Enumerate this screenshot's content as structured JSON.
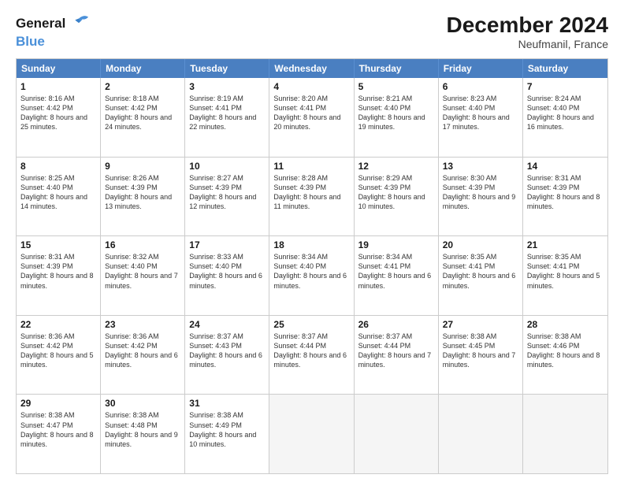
{
  "logo": {
    "line1": "General",
    "line2": "Blue"
  },
  "title": "December 2024",
  "subtitle": "Neufmanil, France",
  "days": [
    "Sunday",
    "Monday",
    "Tuesday",
    "Wednesday",
    "Thursday",
    "Friday",
    "Saturday"
  ],
  "weeks": [
    [
      {
        "day": "1",
        "sunrise": "8:16 AM",
        "sunset": "4:42 PM",
        "daylight": "8 hours and 25 minutes."
      },
      {
        "day": "2",
        "sunrise": "8:18 AM",
        "sunset": "4:42 PM",
        "daylight": "8 hours and 24 minutes."
      },
      {
        "day": "3",
        "sunrise": "8:19 AM",
        "sunset": "4:41 PM",
        "daylight": "8 hours and 22 minutes."
      },
      {
        "day": "4",
        "sunrise": "8:20 AM",
        "sunset": "4:41 PM",
        "daylight": "8 hours and 20 minutes."
      },
      {
        "day": "5",
        "sunrise": "8:21 AM",
        "sunset": "4:40 PM",
        "daylight": "8 hours and 19 minutes."
      },
      {
        "day": "6",
        "sunrise": "8:23 AM",
        "sunset": "4:40 PM",
        "daylight": "8 hours and 17 minutes."
      },
      {
        "day": "7",
        "sunrise": "8:24 AM",
        "sunset": "4:40 PM",
        "daylight": "8 hours and 16 minutes."
      }
    ],
    [
      {
        "day": "8",
        "sunrise": "8:25 AM",
        "sunset": "4:40 PM",
        "daylight": "8 hours and 14 minutes."
      },
      {
        "day": "9",
        "sunrise": "8:26 AM",
        "sunset": "4:39 PM",
        "daylight": "8 hours and 13 minutes."
      },
      {
        "day": "10",
        "sunrise": "8:27 AM",
        "sunset": "4:39 PM",
        "daylight": "8 hours and 12 minutes."
      },
      {
        "day": "11",
        "sunrise": "8:28 AM",
        "sunset": "4:39 PM",
        "daylight": "8 hours and 11 minutes."
      },
      {
        "day": "12",
        "sunrise": "8:29 AM",
        "sunset": "4:39 PM",
        "daylight": "8 hours and 10 minutes."
      },
      {
        "day": "13",
        "sunrise": "8:30 AM",
        "sunset": "4:39 PM",
        "daylight": "8 hours and 9 minutes."
      },
      {
        "day": "14",
        "sunrise": "8:31 AM",
        "sunset": "4:39 PM",
        "daylight": "8 hours and 8 minutes."
      }
    ],
    [
      {
        "day": "15",
        "sunrise": "8:31 AM",
        "sunset": "4:39 PM",
        "daylight": "8 hours and 8 minutes."
      },
      {
        "day": "16",
        "sunrise": "8:32 AM",
        "sunset": "4:40 PM",
        "daylight": "8 hours and 7 minutes."
      },
      {
        "day": "17",
        "sunrise": "8:33 AM",
        "sunset": "4:40 PM",
        "daylight": "8 hours and 6 minutes."
      },
      {
        "day": "18",
        "sunrise": "8:34 AM",
        "sunset": "4:40 PM",
        "daylight": "8 hours and 6 minutes."
      },
      {
        "day": "19",
        "sunrise": "8:34 AM",
        "sunset": "4:41 PM",
        "daylight": "8 hours and 6 minutes."
      },
      {
        "day": "20",
        "sunrise": "8:35 AM",
        "sunset": "4:41 PM",
        "daylight": "8 hours and 6 minutes."
      },
      {
        "day": "21",
        "sunrise": "8:35 AM",
        "sunset": "4:41 PM",
        "daylight": "8 hours and 5 minutes."
      }
    ],
    [
      {
        "day": "22",
        "sunrise": "8:36 AM",
        "sunset": "4:42 PM",
        "daylight": "8 hours and 5 minutes."
      },
      {
        "day": "23",
        "sunrise": "8:36 AM",
        "sunset": "4:42 PM",
        "daylight": "8 hours and 6 minutes."
      },
      {
        "day": "24",
        "sunrise": "8:37 AM",
        "sunset": "4:43 PM",
        "daylight": "8 hours and 6 minutes."
      },
      {
        "day": "25",
        "sunrise": "8:37 AM",
        "sunset": "4:44 PM",
        "daylight": "8 hours and 6 minutes."
      },
      {
        "day": "26",
        "sunrise": "8:37 AM",
        "sunset": "4:44 PM",
        "daylight": "8 hours and 7 minutes."
      },
      {
        "day": "27",
        "sunrise": "8:38 AM",
        "sunset": "4:45 PM",
        "daylight": "8 hours and 7 minutes."
      },
      {
        "day": "28",
        "sunrise": "8:38 AM",
        "sunset": "4:46 PM",
        "daylight": "8 hours and 8 minutes."
      }
    ],
    [
      {
        "day": "29",
        "sunrise": "8:38 AM",
        "sunset": "4:47 PM",
        "daylight": "8 hours and 8 minutes."
      },
      {
        "day": "30",
        "sunrise": "8:38 AM",
        "sunset": "4:48 PM",
        "daylight": "8 hours and 9 minutes."
      },
      {
        "day": "31",
        "sunrise": "8:38 AM",
        "sunset": "4:49 PM",
        "daylight": "8 hours and 10 minutes."
      },
      null,
      null,
      null,
      null
    ]
  ]
}
